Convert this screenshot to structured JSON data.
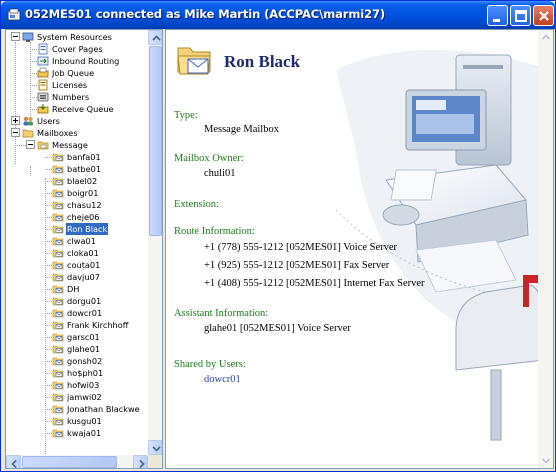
{
  "window": {
    "title": "052MES01 connected as Mike Martin (ACCPAC\\marmi27)"
  },
  "tree": {
    "system_resources": "System Resources",
    "system_children": [
      "Cover Pages",
      "Inbound Routing",
      "Job Queue",
      "Licenses",
      "Numbers",
      "Receive Queue"
    ],
    "users": "Users",
    "mailboxes": "Mailboxes",
    "message": "Message",
    "mailbox_items": [
      "banfa01",
      "batbe01",
      "blael02",
      "boigr01",
      "chasu12",
      "cheje06",
      "Ron Black",
      "clwa01",
      "cloka01",
      "couta01",
      "davju07",
      "DH",
      "dorgu01",
      "dowcr01",
      "Frank Kirchhoff",
      "garsc01",
      "glahe01",
      "gonsh02",
      "ho$ph01",
      "hofwi03",
      "jamwi02",
      "Jonathan Blackwe",
      "kusgu01",
      "kwaja01"
    ],
    "selected_index": 6
  },
  "detail": {
    "name": "Ron Black",
    "type_label": "Type:",
    "type_value": "Message Mailbox",
    "owner_label": "Mailbox Owner:",
    "owner_value": "chuli01",
    "extension_label": "Extension:",
    "route_label": "Route Information:",
    "routes": [
      "+1 (778) 555-1212 [052MES01] Voice Server",
      "+1 (925) 555-1212 [052MES01] Fax Server",
      "+1 (408) 555-1212 [052MES01] Internet Fax Server"
    ],
    "assistant_label": "Assistant Information:",
    "assistant_value": "glahe01 [052MES01] Voice Server",
    "shared_label": "Shared by Users:",
    "shared_value": "dowcr01"
  },
  "colors": {
    "titlebar": "#0054E3",
    "selection": "#316AC5",
    "label_green": "#1E7A1E",
    "name_blue": "#1F2A6E"
  }
}
